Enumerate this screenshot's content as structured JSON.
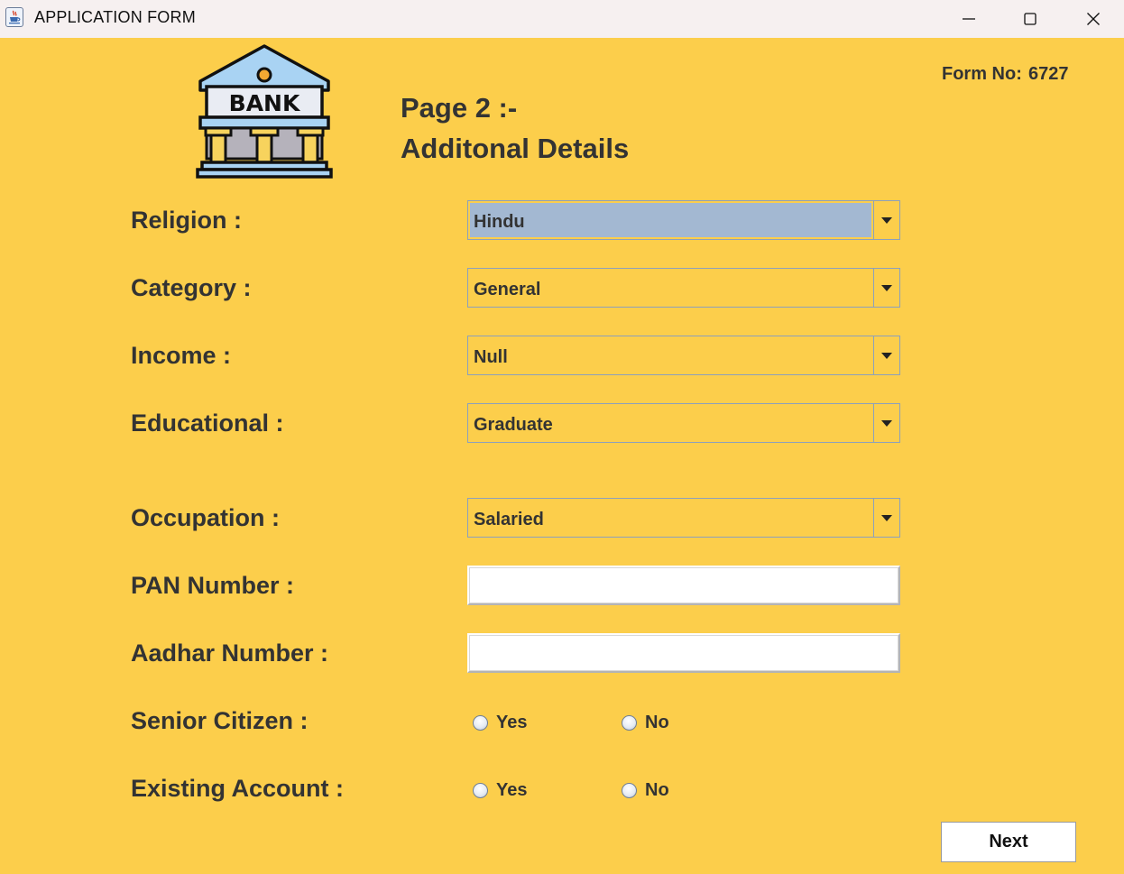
{
  "window": {
    "title": "APPLICATION FORM",
    "icon": "java-cup-icon",
    "controls": [
      "minimize-icon",
      "maximize-icon",
      "close-icon"
    ]
  },
  "header": {
    "logo_text": "BANK",
    "form_no_label": "Form No:",
    "form_no_value": "6727",
    "page_title": "Page 2 :-",
    "page_subtitle": "Additonal Details"
  },
  "fields": {
    "religion": {
      "label": "Religion :",
      "value": "Hindu"
    },
    "category": {
      "label": "Category :",
      "value": "General"
    },
    "income": {
      "label": "Income :",
      "value": "Null"
    },
    "educational": {
      "label": "Educational :",
      "value": "Graduate"
    },
    "occupation": {
      "label": "Occupation :",
      "value": "Salaried"
    },
    "pan": {
      "label": "PAN Number :",
      "value": ""
    },
    "aadhar": {
      "label": "Aadhar Number :",
      "value": ""
    },
    "senior_citizen": {
      "label": "Senior Citizen :",
      "yes": "Yes",
      "no": "No"
    },
    "existing_account": {
      "label": "Existing Account :",
      "yes": "Yes",
      "no": "No"
    }
  },
  "actions": {
    "next_label": "Next"
  },
  "colors": {
    "background": "#fcce4b",
    "selected_combo": "#a3b8d2",
    "text": "#333333"
  }
}
